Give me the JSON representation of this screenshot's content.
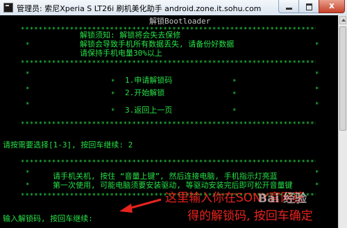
{
  "window": {
    "title": "管理员: 索尼Xperia S LT26i 刷机美化助手 android.zone.it.sohu.com",
    "close_label": "x"
  },
  "console": {
    "heading": "解锁Bootloader",
    "notice_line1": "解锁须知: 解锁将会失去保修",
    "notice_line2": "解锁会导致手机所有数据丢失, 请备份好数据",
    "notice_line3": "请保持手机电量30%以上",
    "menu_item1": "1.申请解锁码",
    "menu_item2": "2.开始解锁",
    "menu_item3": "3.返回上一页",
    "prompt_select": "请按需要选择[1-3], 按回车继续: 2",
    "instruction_line1": "请手机关机, 按住 “音量上键”, 然后连接电脑, 手机指示灯亮蓝",
    "instruction_line2": "第一次使用, 可能电脑须要安装驱动, 等驱动安装完后即可松开音量键",
    "prompt_code": "输入解锁码, 按回车继续:",
    "star_char": "*"
  },
  "annotation": {
    "line1": "这里输入你在SONY官网获",
    "line2": "得的解锁码, 按回车确定"
  },
  "watermark": {
    "text": "Bai 经验"
  }
}
